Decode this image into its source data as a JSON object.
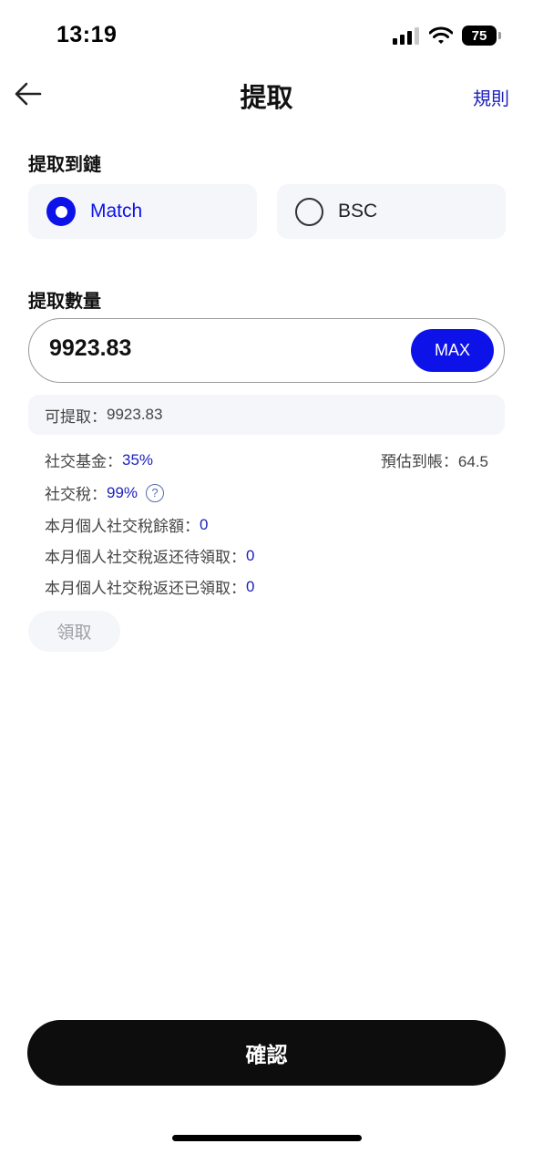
{
  "status_bar": {
    "time": "13:19",
    "battery": "75"
  },
  "nav": {
    "title": "提取",
    "rules_label": "規則"
  },
  "chain_section": {
    "label": "提取到鏈",
    "options": [
      {
        "label": "Match",
        "selected": true
      },
      {
        "label": "BSC",
        "selected": false
      }
    ]
  },
  "amount_section": {
    "label": "提取數量",
    "value": "9923.83",
    "max_label": "MAX"
  },
  "available": {
    "label": "可提取：",
    "value": "9923.83"
  },
  "fee_info": {
    "social_fund_label": "社交基金：",
    "social_fund_value": "35%",
    "estimate_label": "預估到帳：",
    "estimate_value": "64.5",
    "social_tax_label": "社交稅：",
    "social_tax_value": "99%",
    "monthly_balance_label": "本月個人社交稅餘額：",
    "monthly_balance_value": "0",
    "pending_refund_label": "本月個人社交稅返还待領取：",
    "pending_refund_value": "0",
    "claimed_refund_label": "本月個人社交稅返还已領取：",
    "claimed_refund_value": "0"
  },
  "claim_button": "領取",
  "confirm_button": "確認",
  "icons": {
    "back": "arrow-left-icon",
    "help": "question-circle-icon",
    "signal": "cellular-signal-icon",
    "wifi": "wifi-icon",
    "battery": "battery-icon"
  },
  "colors": {
    "accent": "#0d12e8",
    "link": "#1a1fbd",
    "card_bg": "#f5f6fa",
    "primary_button": "#0d0d0d"
  }
}
